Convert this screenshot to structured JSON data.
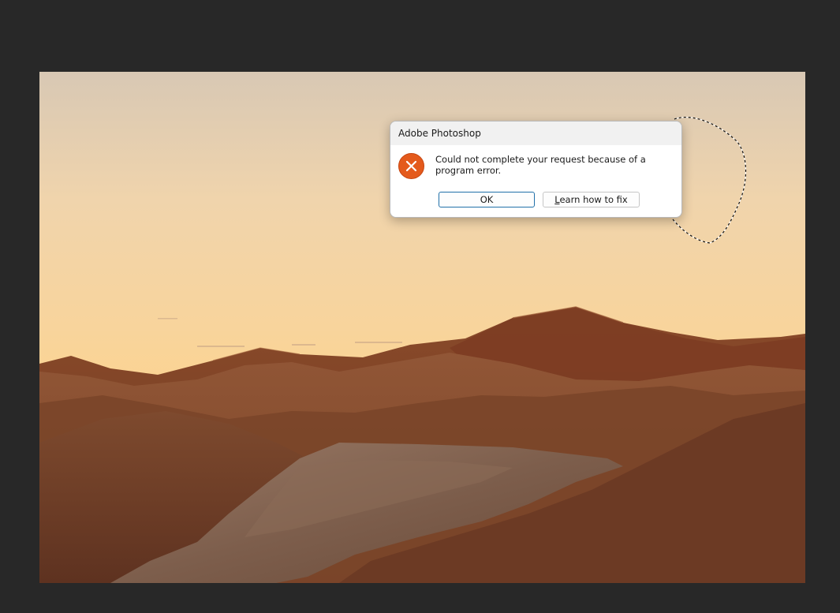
{
  "dialog": {
    "title": "Adobe Photoshop",
    "icon": "error-x-icon",
    "message": "Could not complete your request because of a program error.",
    "ok_label": "OK",
    "fix_label_mnemonic": "L",
    "fix_label_rest": "earn how to fix"
  },
  "colors": {
    "workspace_bg": "#282828",
    "error_icon": "#e45a1c",
    "ok_button_border": "#1f6fa8"
  }
}
